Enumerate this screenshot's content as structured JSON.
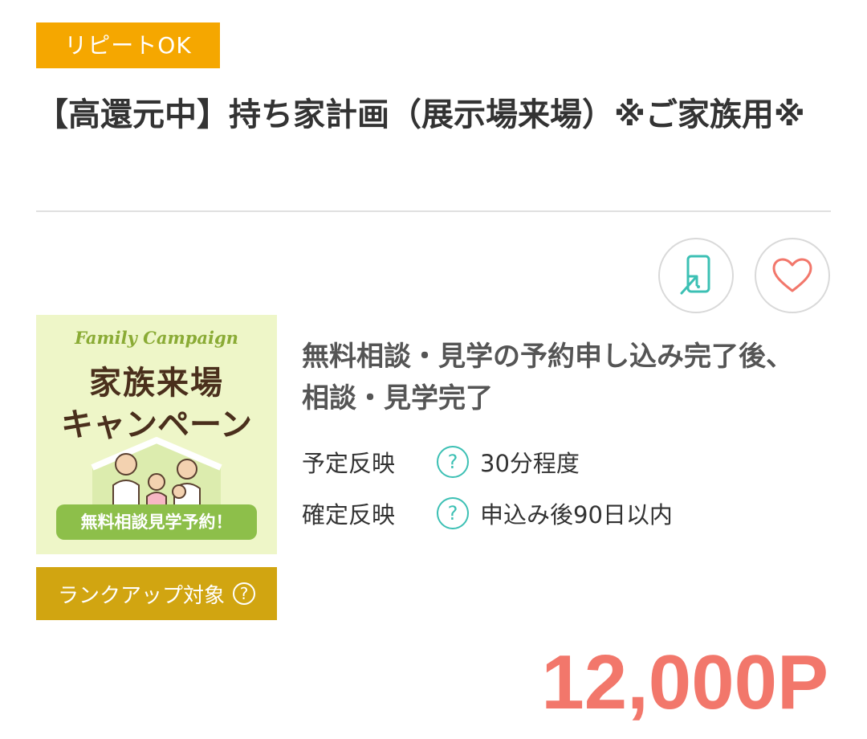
{
  "badge": {
    "repeat": "リピートOK"
  },
  "title": "【高還元中】持ち家計画（展示場来場）※ご家族用※",
  "actions": {
    "share_icon": "phone-share-icon",
    "favorite_icon": "heart-icon"
  },
  "banner": {
    "en_title": "Family Campaign",
    "jp_line1": "家族来場",
    "jp_line2": "キャンペーン",
    "pill": "無料相談見学予約！"
  },
  "rankup": {
    "label": "ランクアップ対象",
    "help": "?"
  },
  "condition": "無料相談・見学の予約申し込み完了後、相談・見学完了",
  "info": {
    "planned_label": "予定反映",
    "planned_value": "30分程度",
    "confirmed_label": "確定反映",
    "confirmed_value": "申込み後90日以内",
    "help": "?"
  },
  "points": "12,000P",
  "colors": {
    "badge": "#f5a700",
    "rankup": "#d1a511",
    "accent_teal": "#3cc0b4",
    "heart": "#f2776b",
    "points": "#f2776b"
  }
}
